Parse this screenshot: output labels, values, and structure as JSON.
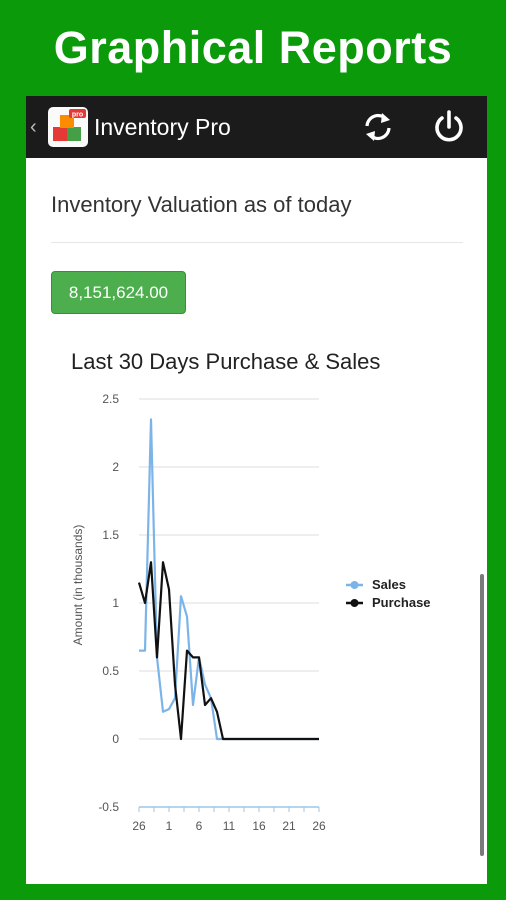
{
  "banner": {
    "title": "Graphical Reports"
  },
  "actionbar": {
    "back_icon": "chevron-left-icon",
    "app_icon": "inventory-boxes-icon",
    "app_title": "Inventory Pro",
    "refresh_icon": "refresh-icon",
    "power_icon": "power-icon"
  },
  "content": {
    "valuation_title": "Inventory Valuation as of today",
    "valuation_value": "8,151,624.00"
  },
  "colors": {
    "sales": "#7db4e8",
    "purchase": "#111111",
    "button": "#4cae4c"
  },
  "chart_data": {
    "type": "line",
    "title": "Last 30 Days Purchase & Sales",
    "ylabel": "Amount (in thousands)",
    "xlabel": "",
    "ylim": [
      -0.5,
      2.5
    ],
    "yticks": [
      "2.5",
      "2",
      "1.5",
      "1",
      "0.5",
      "0",
      "-0.5"
    ],
    "ytick_values": [
      2.5,
      2,
      1.5,
      1,
      0.5,
      0,
      -0.5
    ],
    "xlim": [
      0,
      30
    ],
    "xticks": [
      "26",
      "1",
      "6",
      "11",
      "16",
      "21",
      "26"
    ],
    "xtick_positions": [
      0,
      5,
      10,
      15,
      20,
      25,
      30
    ],
    "legend_position": "right",
    "series": [
      {
        "name": "Sales",
        "x": [
          0,
          1,
          2,
          3,
          4,
          5,
          6,
          7,
          8,
          9,
          10,
          11,
          12,
          13,
          14,
          15,
          16,
          17,
          18,
          19,
          20,
          21,
          22,
          23,
          24,
          25,
          26,
          27,
          28,
          29,
          30
        ],
        "values": [
          0.65,
          0.65,
          2.35,
          0.6,
          0.2,
          0.22,
          0.3,
          1.05,
          0.9,
          0.25,
          0.6,
          0.4,
          0.3,
          0.0,
          0,
          0,
          0,
          0,
          0,
          0,
          0,
          0,
          0,
          0,
          0,
          0,
          0,
          0,
          0,
          0,
          0
        ]
      },
      {
        "name": "Purchase",
        "x": [
          0,
          1,
          2,
          3,
          4,
          5,
          6,
          7,
          8,
          9,
          10,
          11,
          12,
          13,
          14,
          15,
          16,
          17,
          18,
          19,
          20,
          21,
          22,
          23,
          24,
          25,
          26,
          27,
          28,
          29,
          30
        ],
        "values": [
          1.15,
          1.0,
          1.3,
          0.6,
          1.3,
          1.1,
          0.4,
          0.0,
          0.65,
          0.6,
          0.6,
          0.25,
          0.3,
          0.2,
          0.0,
          0,
          0,
          0,
          0,
          0,
          0,
          0,
          0,
          0,
          0,
          0,
          0,
          0,
          0,
          0,
          0
        ]
      }
    ]
  }
}
